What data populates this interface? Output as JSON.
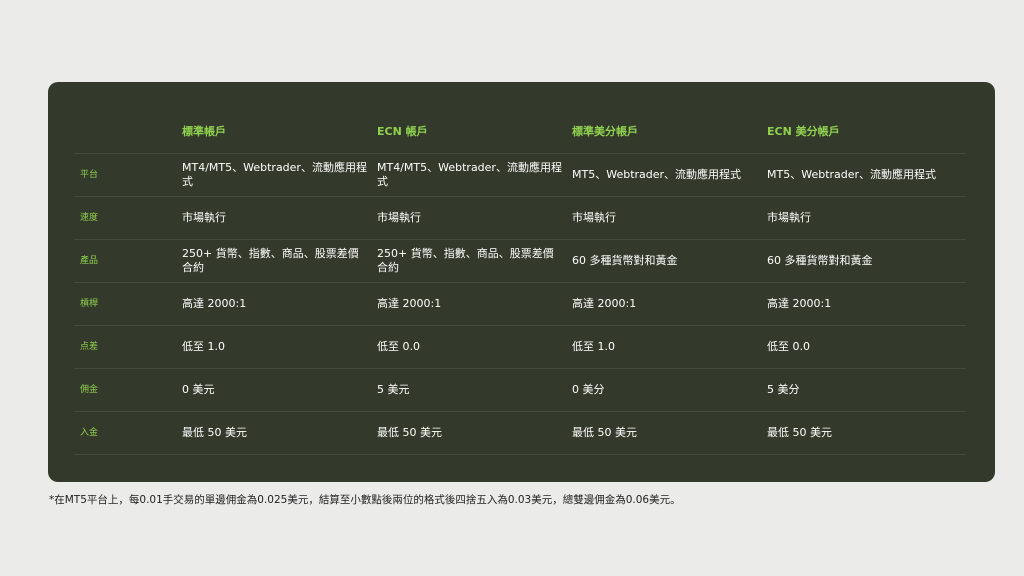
{
  "columns": [
    "標準帳戶",
    "ECN 帳戶",
    "標準美分帳戶",
    "ECN 美分帳戶"
  ],
  "rows": [
    {
      "label": "平台",
      "cells": [
        "MT4/MT5、Webtrader、流動應用程式",
        "MT4/MT5、Webtrader、流動應用程式",
        "MT5、Webtrader、流動應用程式",
        "MT5、Webtrader、流動應用程式"
      ]
    },
    {
      "label": "速度",
      "cells": [
        "市場執行",
        "市場執行",
        "市場執行",
        "市場執行"
      ]
    },
    {
      "label": "產品",
      "cells": [
        "250+ 貨幣、指數、商品、股票差價合約",
        "250+ 貨幣、指數、商品、股票差價合約",
        "60 多種貨幣對和黃金",
        "60 多種貨幣對和黃金"
      ]
    },
    {
      "label": "槓桿",
      "cells": [
        "高達 2000:1",
        "高達 2000:1",
        "高達 2000:1",
        "高達 2000:1"
      ]
    },
    {
      "label": "点差",
      "cells": [
        "低至 1.0",
        "低至 0.0",
        "低至 1.0",
        "低至 0.0"
      ]
    },
    {
      "label": "佣金",
      "cells": [
        "0 美元",
        "5 美元",
        "0 美分",
        "5 美分"
      ]
    },
    {
      "label": "入金",
      "cells": [
        "最低 50 美元",
        "最低 50 美元",
        "最低 50 美元",
        "最低 50 美元"
      ]
    }
  ],
  "footnote": "*在MT5平台上，每0.01手交易的單邊佣金為0.025美元，結算至小數點後兩位的格式後四捨五入為0.03美元，總雙邊佣金為0.06美元。"
}
